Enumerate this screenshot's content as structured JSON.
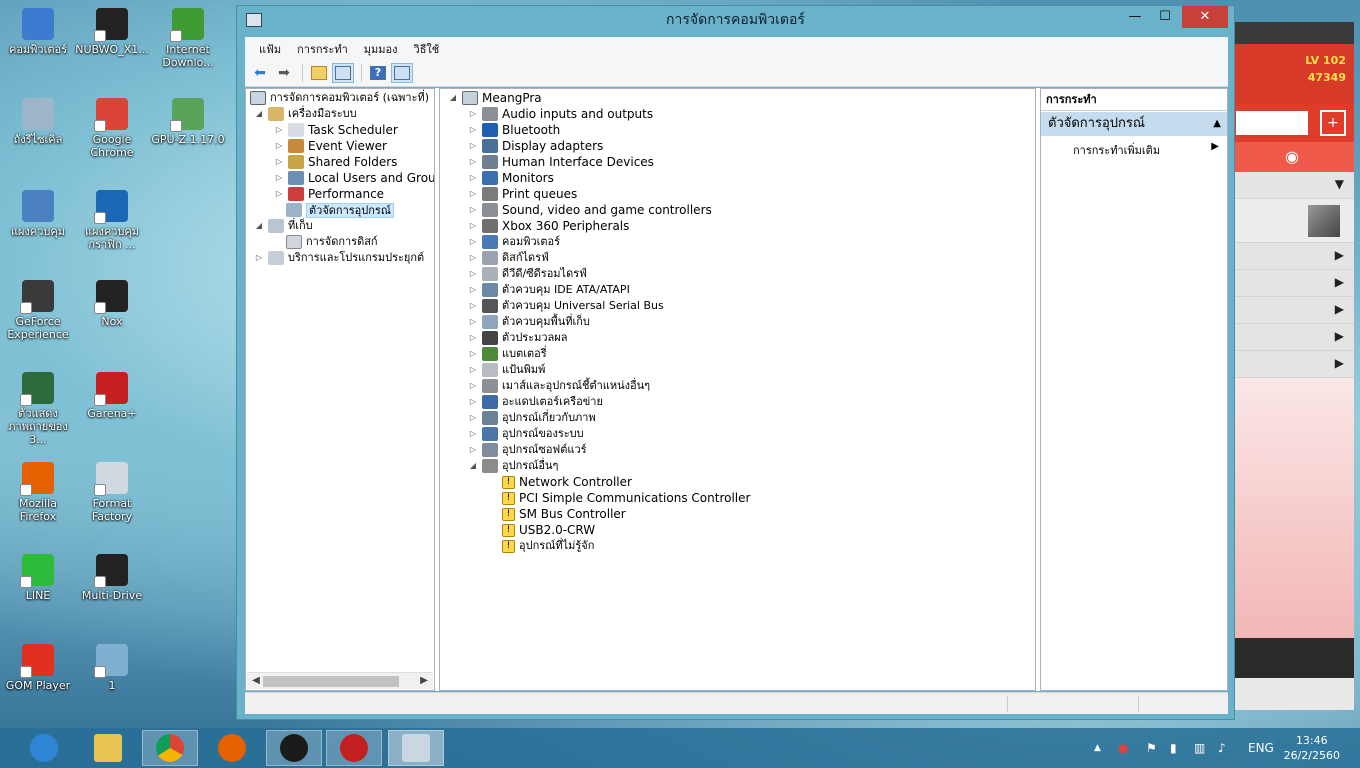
{
  "desktop": {
    "icons": [
      {
        "label": "คอมพิวเตอร์",
        "color": "#3c7bd0"
      },
      {
        "label": "NUBWO_X1...",
        "color": "#222"
      },
      {
        "label": "Internet Downlo...",
        "color": "#3f9c35"
      },
      {
        "label": "ถังรีไซเคิล",
        "color": "#9db5c8"
      },
      {
        "label": "Google Chrome",
        "color": "#db4437"
      },
      {
        "label": "GPU-Z.1.17.0",
        "color": "#5aa35a"
      },
      {
        "label": "แผงควบคุม",
        "color": "#4a7fc0"
      },
      {
        "label": "แผงควบคุมกราฟิก ...",
        "color": "#1a67b3"
      },
      {
        "label": "GeForce Experience",
        "color": "#3a3a3a"
      },
      {
        "label": "Nox",
        "color": "#222"
      },
      {
        "label": "ตัวแสดงภาพถ่ายของ 3...",
        "color": "#2d6b3a"
      },
      {
        "label": "Garena+",
        "color": "#c42020"
      },
      {
        "label": "Mozilla Firefox",
        "color": "#e66000"
      },
      {
        "label": "Format Factory",
        "color": "#d0d8e0"
      },
      {
        "label": "LINE",
        "color": "#2dbb3a"
      },
      {
        "label": "Multi-Drive",
        "color": "#222"
      },
      {
        "label": "GOM Player",
        "color": "#e03020"
      },
      {
        "label": "1",
        "color": "#7fb0d0"
      }
    ]
  },
  "bgapp": {
    "level": "LV 102",
    "coins": "47349"
  },
  "window": {
    "title": "การจัดการคอมพิวเตอร์",
    "controls": {
      "minimize": "—",
      "maximize": "☐",
      "close": "✕"
    },
    "menu": [
      "แฟ้ม",
      "การกระทำ",
      "มุมมอง",
      "วิธีใช้"
    ],
    "toolbar_icons": [
      "back-arrow-icon",
      "forward-arrow-icon",
      "up-folder-icon",
      "show-hide-tree-icon",
      "help-icon",
      "show-hide-action-pane-icon"
    ],
    "left_tree": {
      "root": "การจัดการคอมพิวเตอร์ (เฉพาะที่)",
      "system_tools": "เครื่องมือระบบ",
      "children": [
        "Task Scheduler",
        "Event Viewer",
        "Shared Folders",
        "Local Users and Groups",
        "Performance",
        "ตัวจัดการอุปกรณ์"
      ],
      "storage": "ที่เก็บ",
      "storage_children": [
        "การจัดการดิสก์"
      ],
      "services": "บริการและโปรแกรมประยุกต์"
    },
    "device_tree": {
      "computer_name": "MeangPra",
      "categories": [
        "Audio inputs and outputs",
        "Bluetooth",
        "Display adapters",
        "Human Interface Devices",
        "Monitors",
        "Print queues",
        "Sound, video and game controllers",
        "Xbox 360 Peripherals",
        "คอมพิวเตอร์",
        "ดิสก์ไดรฟ์",
        "ดีวีดี/ซีดีรอมไดรฟ์",
        "ตัวควบคุม IDE ATA/ATAPI",
        "ตัวควบคุม Universal Serial Bus",
        "ตัวควบคุมพื้นที่เก็บ",
        "ตัวประมวลผล",
        "แบตเตอรี่",
        "แป้นพิมพ์",
        "เมาส์และอุปกรณ์ชี้ตำแหน่งอื่นๆ",
        "อะแดปเตอร์เครือข่าย",
        "อุปกรณ์เกี่ยวกับภาพ",
        "อุปกรณ์ของระบบ",
        "อุปกรณ์ซอฟต์แวร์",
        "อุปกรณ์อื่นๆ"
      ],
      "other_devices": [
        "Network Controller",
        "PCI Simple Communications Controller",
        "SM Bus Controller",
        "USB2.0-CRW",
        "อุปกรณ์ที่ไม่รู้จัก"
      ]
    },
    "actions": {
      "header": "การกระทำ",
      "section": "ตัวจัดการอุปกรณ์",
      "more": "การกระทำเพิ่มเติม"
    }
  },
  "taskbar": {
    "apps": [
      "internet-explorer-icon",
      "file-explorer-icon",
      "chrome-icon",
      "firefox-icon",
      "nox-icon",
      "garena-icon",
      "computer-management-icon"
    ],
    "language": "ENG",
    "time": "13:46",
    "date": "26/2/2560"
  }
}
